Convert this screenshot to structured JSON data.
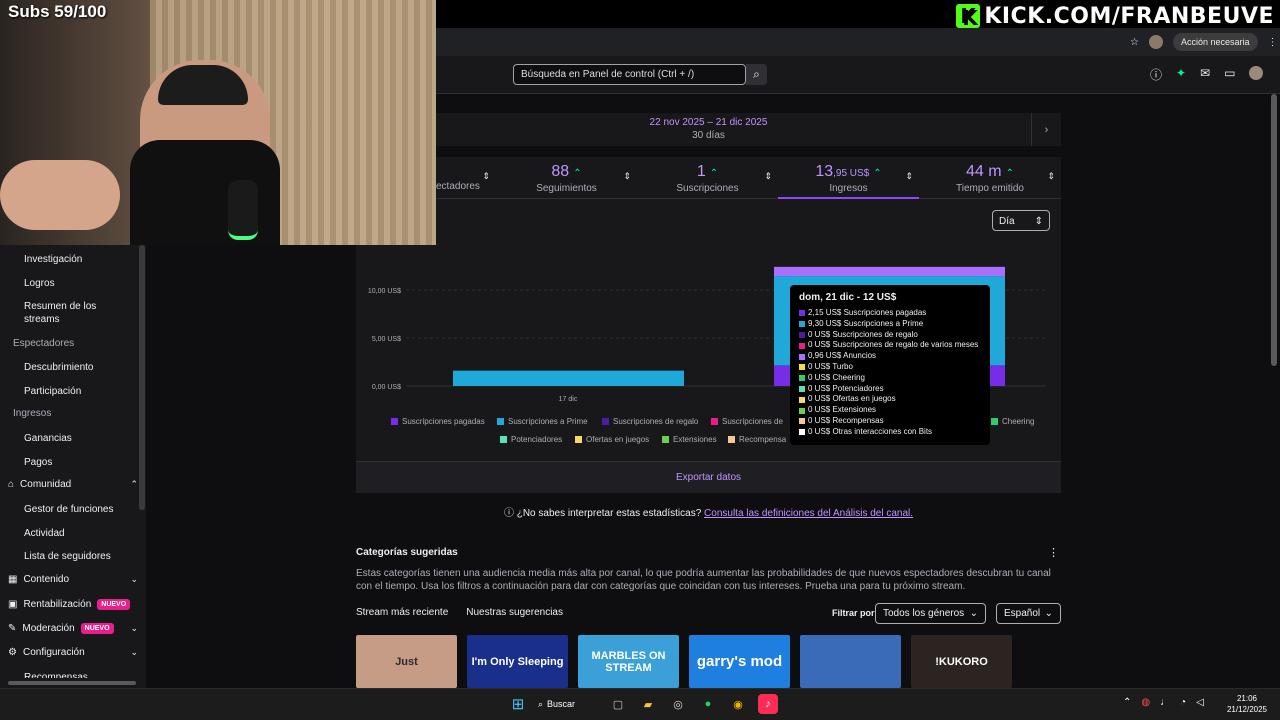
{
  "overlay": {
    "subs": "Subs 59/100",
    "kick_letter": "K",
    "kick_text": "KICK.COM/FRANBEUVE"
  },
  "browser": {
    "action_label": "Acción necesaria"
  },
  "topnav": {
    "search_placeholder": "Búsqueda en Panel de control (Ctrl + /)"
  },
  "sidebar": {
    "items": [
      {
        "label": "Investigación",
        "kind": "item"
      },
      {
        "label": "Logros",
        "kind": "item"
      },
      {
        "label": "Resumen de los streams",
        "kind": "item"
      },
      {
        "label": "Espectadores",
        "kind": "section"
      },
      {
        "label": "Descubrimiento",
        "kind": "item"
      },
      {
        "label": "Participación",
        "kind": "item"
      },
      {
        "label": "Ingresos",
        "kind": "section"
      },
      {
        "label": "Ganancias",
        "kind": "item"
      },
      {
        "label": "Pagos",
        "kind": "item"
      }
    ],
    "groups": [
      {
        "label": "Comunidad",
        "icon": "community-icon",
        "chevron": "up"
      },
      {
        "label": "Contenido",
        "icon": "content-icon",
        "chevron": "down"
      },
      {
        "label": "Rentabilización",
        "icon": "monetization-icon",
        "badge": "NUEVO"
      },
      {
        "label": "Moderación",
        "icon": "moderation-icon",
        "badge": "NUEVO",
        "chevron": "down"
      },
      {
        "label": "Configuración",
        "icon": "settings-icon",
        "chevron": "down"
      }
    ],
    "community_items": [
      "Gestor de funciones",
      "Actividad",
      "Lista de seguidores"
    ],
    "cut_item": "Recompensas"
  },
  "date": {
    "range": "22 nov 2025 – 21 dic 2025",
    "days": "30 días"
  },
  "stats": [
    {
      "value": "",
      "label": "ectadores",
      "cut": true
    },
    {
      "value": "88",
      "label": "Seguimientos"
    },
    {
      "value": "1",
      "label": "Suscripciones"
    },
    {
      "value": "13",
      "value_small": ",95 US$",
      "label": "Ingresos",
      "active": true
    },
    {
      "value": "44 m",
      "label": "Tiempo emitido"
    }
  ],
  "granularity": "Día",
  "chart_data": {
    "type": "bar",
    "stacked": true,
    "y_ticks": [
      "0,00 US$",
      "5,00 US$",
      "10,00 US$"
    ],
    "ylim": [
      0,
      15
    ],
    "x_tick": "17 dic",
    "categories": [
      "17 dic",
      "21 dic"
    ],
    "series": [
      {
        "name": "Suscripciones pagadas",
        "color": "#772ce8",
        "values": [
          0,
          2.15
        ]
      },
      {
        "name": "Suscripciones a Prime",
        "color": "#1fa8d8",
        "values": [
          1.6,
          9.3
        ]
      },
      {
        "name": "Anuncios",
        "color": "#a970ff",
        "values": [
          0,
          0.96
        ]
      }
    ],
    "legend_row1": [
      {
        "name": "Suscripciones pagadas",
        "color": "#772ce8"
      },
      {
        "name": "Suscripciones a Prime",
        "color": "#1fa8d8"
      },
      {
        "name": "Suscripciones de regalo",
        "color": "#4b1ba8"
      },
      {
        "name": "Suscripciones de",
        "color": "#e91e8c"
      },
      {
        "name": "Cheering",
        "color": "#2ecc71"
      }
    ],
    "legend_row2": [
      {
        "name": "Potenciadores",
        "color": "#5de0b8"
      },
      {
        "name": "Ofertas en juegos",
        "color": "#f5d76e"
      },
      {
        "name": "Extensiones",
        "color": "#6bd04a"
      },
      {
        "name": "Recompensa",
        "color": "#f5c89a"
      }
    ]
  },
  "tooltip": {
    "title": "dom, 21 dic - 12 US$",
    "rows": [
      {
        "text": "2,15 US$ Suscripciones pagadas",
        "color": "#772ce8"
      },
      {
        "text": "9,30 US$ Suscripciones a Prime",
        "color": "#1fa8d8"
      },
      {
        "text": "0 US$ Suscripciones de regalo",
        "color": "#4b1ba8"
      },
      {
        "text": "0 US$ Suscripciones de regalo de varios meses",
        "color": "#e91e8c"
      },
      {
        "text": "0,96 US$ Anuncios",
        "color": "#a970ff"
      },
      {
        "text": "0 US$ Turbo",
        "color": "#f0e040"
      },
      {
        "text": "0 US$ Cheering",
        "color": "#2ecc71"
      },
      {
        "text": "0 US$ Potenciadores",
        "color": "#5de0b8"
      },
      {
        "text": "0 US$ Ofertas en juegos",
        "color": "#f5d76e"
      },
      {
        "text": "0 US$ Extensiones",
        "color": "#6bd04a"
      },
      {
        "text": "0 US$ Recompensas",
        "color": "#f5c89a"
      },
      {
        "text": "0 US$ Otras interacciones con Bits",
        "color": "#ffffff"
      }
    ]
  },
  "export_label": "Exportar datos",
  "help": {
    "question": "¿No sabes interpretar estas estadísticas?",
    "link": "Consulta las definiciones del Análisis del canal."
  },
  "suggested": {
    "title": "Categorías sugeridas",
    "description": "Estas categorías tienen una audiencia media más alta por canal, lo que podría aumentar las probabilidades de que nuevos espectadores descubran tu canal con el tiempo. Usa los filtros a continuación para dar con categorías que coincidan con tus intereses. Prueba una para tu próximo stream.",
    "tabs": [
      "Stream más reciente",
      "Nuestras sugerencias"
    ],
    "filter_label": "Filtrar por",
    "genre": "Todos los géneros",
    "language": "Español",
    "cards": [
      {
        "text": "Just",
        "bg": "#c79c86",
        "fg": "#2b2b2b"
      },
      {
        "text": "I'm Only Sleeping",
        "bg": "#1a2f8a",
        "fg": "#ffffff"
      },
      {
        "text": "MARBLES ON STREAM",
        "bg": "#3ba0d8",
        "fg": "#ffffff"
      },
      {
        "text": "garry's mod",
        "bg": "#1e7fe0",
        "fg": "#ffffff"
      },
      {
        "text": "",
        "bg": "#3a6bb8",
        "fg": "#ffffff"
      },
      {
        "text": "!KUKORO",
        "bg": "#2b2420",
        "fg": "#ffffff"
      }
    ]
  },
  "taskbar": {
    "search": "Buscar",
    "time": "21:06",
    "date": "21/12/2025"
  }
}
